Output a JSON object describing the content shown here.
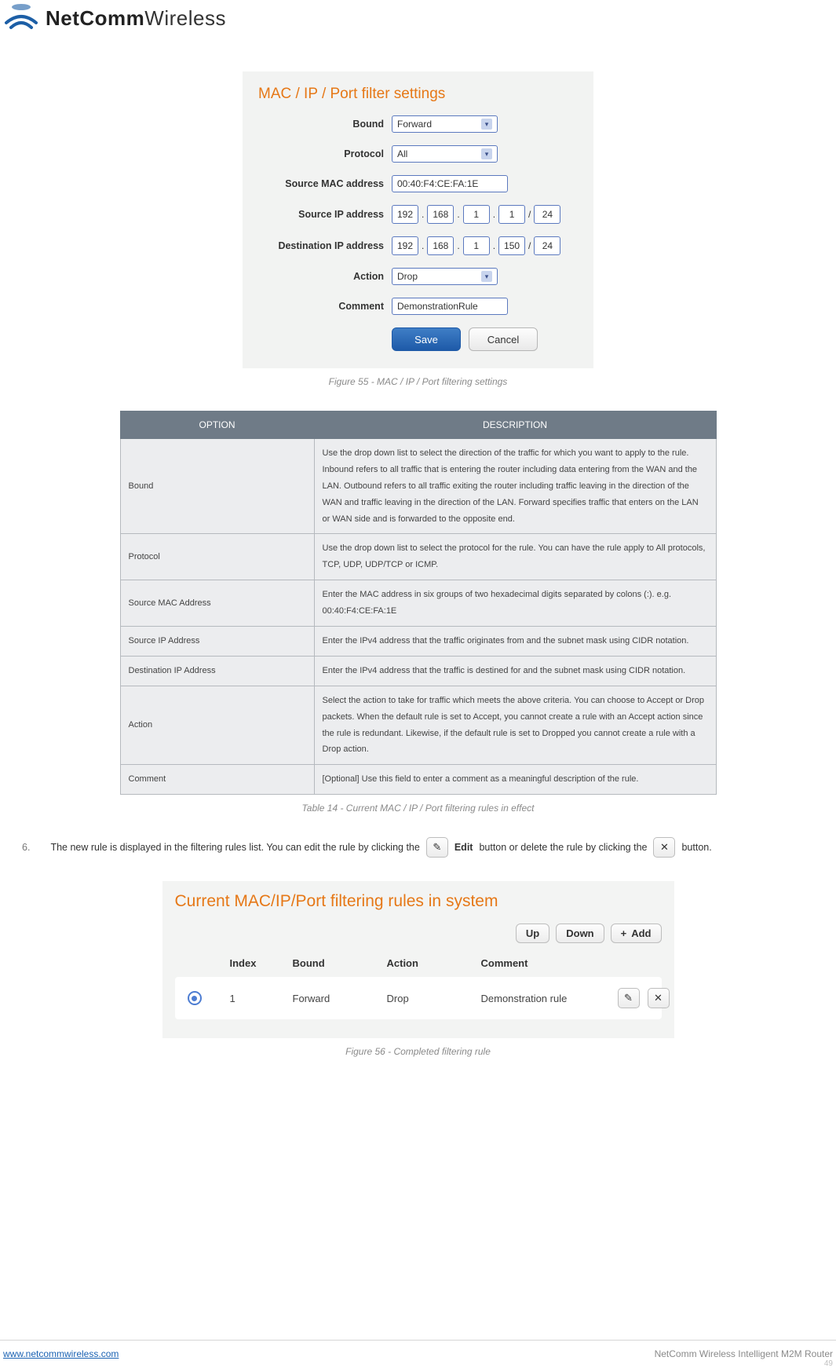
{
  "logo": {
    "bold": "NetComm",
    "light": "Wireless"
  },
  "panel1": {
    "title": "MAC / IP / Port filter settings",
    "labels": {
      "bound": "Bound",
      "protocol": "Protocol",
      "src_mac": "Source MAC address",
      "src_ip": "Source IP address",
      "dest_ip": "Destination IP address",
      "action": "Action",
      "comment": "Comment"
    },
    "values": {
      "bound": "Forward",
      "protocol": "All",
      "src_mac": "00:40:F4:CE:FA:1E",
      "src_ip": [
        "192",
        "168",
        "1",
        "1"
      ],
      "src_cidr": "24",
      "dest_ip": [
        "192",
        "168",
        "1",
        "150"
      ],
      "dest_cidr": "24",
      "action": "Drop",
      "comment": "DemonstrationRule"
    },
    "buttons": {
      "save": "Save",
      "cancel": "Cancel"
    },
    "caption": "Figure 55 - MAC / IP / Port filtering settings"
  },
  "table": {
    "headers": [
      "OPTION",
      "DESCRIPTION"
    ],
    "rows": [
      {
        "opt": "Bound",
        "desc": "Use the drop down list to select the direction of the traffic for which you want to apply to the rule. Inbound refers to all traffic that is entering the router including data entering from the WAN and the LAN. Outbound refers to all traffic exiting the router including traffic leaving in the direction of the WAN and traffic leaving in the direction of the LAN. Forward specifies traffic that enters on the LAN or WAN side and is forwarded to the opposite end."
      },
      {
        "opt": "Protocol",
        "desc": "Use the drop down list to select the protocol for the rule. You can have the rule apply to All protocols, TCP, UDP, UDP/TCP or ICMP."
      },
      {
        "opt": "Source MAC Address",
        "desc": "Enter the MAC address in six groups of two hexadecimal digits separated by colons (:). e.g. 00:40:F4:CE:FA:1E"
      },
      {
        "opt": "Source IP Address",
        "desc": "Enter the IPv4 address that the traffic originates from and the subnet mask using CIDR notation."
      },
      {
        "opt": "Destination IP Address",
        "desc": "Enter the IPv4 address that the traffic is destined for and the subnet mask using CIDR notation."
      },
      {
        "opt": "Action",
        "desc": "Select the action to take for traffic which meets the above criteria. You can choose to Accept or Drop packets. When the default rule is set to Accept, you cannot create a rule with an Accept action since the rule is redundant. Likewise, if the default rule is set to Dropped you cannot create a rule with a Drop action."
      },
      {
        "opt": "Comment",
        "desc": "[Optional] Use this field to enter a comment as a meaningful description of the rule."
      }
    ],
    "caption": "Table 14 - Current MAC / IP / Port filtering rules in effect"
  },
  "step": {
    "num": "6.",
    "text_a": "The new rule is displayed in the filtering rules list. You can edit the rule by clicking the",
    "edit_label": "Edit",
    "text_b": "button or delete the rule by clicking the",
    "text_c": "button."
  },
  "panel2": {
    "title": "Current MAC/IP/Port filtering rules in system",
    "toolbar": {
      "up": "Up",
      "down": "Down",
      "add": "Add"
    },
    "headers": {
      "index": "Index",
      "bound": "Bound",
      "action": "Action",
      "comment": "Comment"
    },
    "row": {
      "index": "1",
      "bound": "Forward",
      "action": "Drop",
      "comment": "Demonstration rule"
    },
    "caption": "Figure 56 - Completed filtering rule"
  },
  "footer": {
    "link": "www.netcommwireless.com",
    "right": "NetComm Wireless Intelligent M2M Router",
    "page": "49"
  }
}
